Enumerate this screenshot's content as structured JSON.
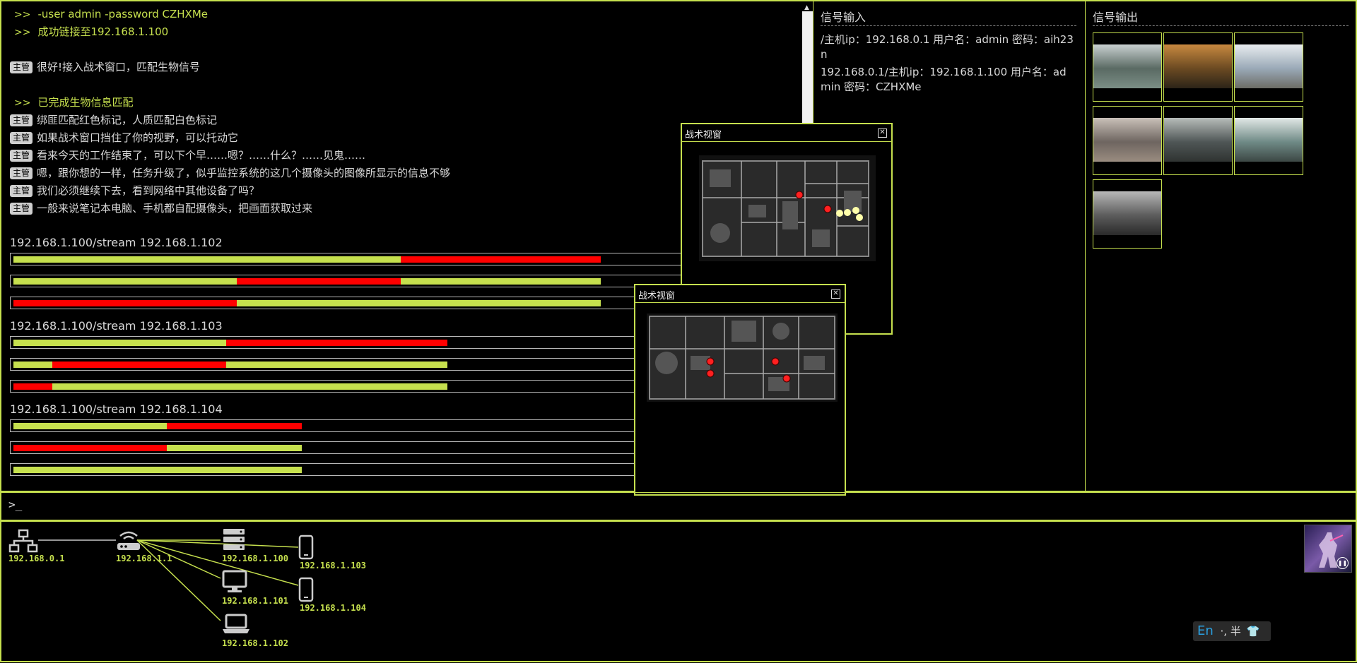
{
  "console": {
    "lines": [
      {
        "prompt": ">>",
        "text": "-user admin -password CZHXMe"
      },
      {
        "prompt": ">>",
        "text": "成功链接至192.168.1.100"
      },
      {
        "tag": "主管",
        "text": "很好!接入战术窗口，匹配生物信号"
      },
      {
        "prompt": ">>",
        "text": "已完成生物信息匹配"
      },
      {
        "tag": "主管",
        "text": "绑匪匹配红色标记，人质匹配白色标记"
      },
      {
        "tag": "主管",
        "text": "如果战术窗口挡住了你的视野，可以托动它"
      },
      {
        "tag": "主管",
        "text": "看来今天的工作结束了，可以下个早……嗯？……什么？……见鬼……"
      },
      {
        "tag": "主管",
        "text": "嗯，跟你想的一样，任务升级了，似乎监控系统的这几个摄像头的图像所显示的信息不够"
      },
      {
        "tag": "主管",
        "text": "我们必须继续下去，看到网络中其他设备了吗？"
      },
      {
        "tag": "主管",
        "text": "一般来说笔记本电脑、手机都自配摄像头，把画面获取过来"
      }
    ],
    "streams": [
      {
        "title": "192.168.1.100/stream 192.168.1.102",
        "bars": [
          [
            {
              "c": "g",
              "s": 0,
              "e": 0.495
            },
            {
              "c": "r",
              "s": 0.495,
              "e": 0.75
            }
          ],
          [
            {
              "c": "g",
              "s": 0,
              "e": 0.285
            },
            {
              "c": "r",
              "s": 0.285,
              "e": 0.495
            },
            {
              "c": "g",
              "s": 0.495,
              "e": 0.75
            }
          ],
          [
            {
              "c": "r",
              "s": 0,
              "e": 0.285
            },
            {
              "c": "g",
              "s": 0.285,
              "e": 0.75
            }
          ]
        ]
      },
      {
        "title": "192.168.1.100/stream 192.168.1.103",
        "bars": [
          [
            {
              "c": "g",
              "s": 0,
              "e": 0.272
            },
            {
              "c": "r",
              "s": 0.272,
              "e": 0.554
            }
          ],
          [
            {
              "c": "g",
              "s": 0,
              "e": 0.05
            },
            {
              "c": "r",
              "s": 0.05,
              "e": 0.272
            },
            {
              "c": "g",
              "s": 0.272,
              "e": 0.554
            }
          ],
          [
            {
              "c": "r",
              "s": 0,
              "e": 0.05
            },
            {
              "c": "g",
              "s": 0.05,
              "e": 0.554
            }
          ]
        ]
      },
      {
        "title": "192.168.1.100/stream 192.168.1.104",
        "bars": [
          [
            {
              "c": "g",
              "s": 0,
              "e": 0.196
            },
            {
              "c": "r",
              "s": 0.196,
              "e": 0.368
            }
          ],
          [
            {
              "c": "r",
              "s": 0,
              "e": 0.196
            },
            {
              "c": "g",
              "s": 0.196,
              "e": 0.368
            }
          ],
          [
            {
              "c": "g",
              "s": 0,
              "e": 0.368
            }
          ]
        ]
      }
    ]
  },
  "signal_input": {
    "title": "信号输入",
    "lines": [
      "/主机ip：192.168.0.1 用户名：admin 密码：aih23n",
      "192.168.0.1/主机ip：192.168.1.100 用户名：admin 密码：CZHXMe"
    ]
  },
  "signal_output": {
    "title": "信号输出",
    "thumbnails": [
      {
        "colors": [
          "#5a6a63",
          "#c9d0d1",
          "#7b8e86"
        ]
      },
      {
        "colors": [
          "#6b4a22",
          "#c8893f",
          "#2c2418"
        ]
      },
      {
        "colors": [
          "#9aa9b7",
          "#e8ecef",
          "#6c6c66"
        ]
      },
      {
        "colors": [
          "#6e6560",
          "#c9c0b8",
          "#9a8c80"
        ]
      },
      {
        "colors": [
          "#4f5656",
          "#b7bcb9",
          "#2f3331"
        ]
      },
      {
        "colors": [
          "#6f8a86",
          "#e2e8e6",
          "#3c4744"
        ]
      },
      {
        "colors": [
          "#5c5c5c",
          "#b8b8b8",
          "#2a2a2a"
        ]
      }
    ]
  },
  "tactical_windows": [
    {
      "title": "战术视窗",
      "close": "✕"
    },
    {
      "title": "战术视窗",
      "close": "✕"
    }
  ],
  "command_bar": {
    "prompt": ">_"
  },
  "network": {
    "nodes": [
      {
        "label": "192.168.0.1",
        "icon": "network-icon"
      },
      {
        "label": "192.168.1.1",
        "icon": "router-icon"
      },
      {
        "label": "192.168.1.100",
        "icon": "server-icon"
      },
      {
        "label": "192.168.1.101",
        "icon": "desktop-icon"
      },
      {
        "label": "192.168.1.102",
        "icon": "laptop-icon"
      },
      {
        "label": "192.168.1.103",
        "icon": "phone-icon"
      },
      {
        "label": "192.168.1.104",
        "icon": "phone-icon"
      }
    ]
  },
  "ime": {
    "lang": "En",
    "mode": "·, 半"
  },
  "colors": {
    "accent": "#c6e04e",
    "red": "#ff0000",
    "hostage": "#ffffaa"
  }
}
